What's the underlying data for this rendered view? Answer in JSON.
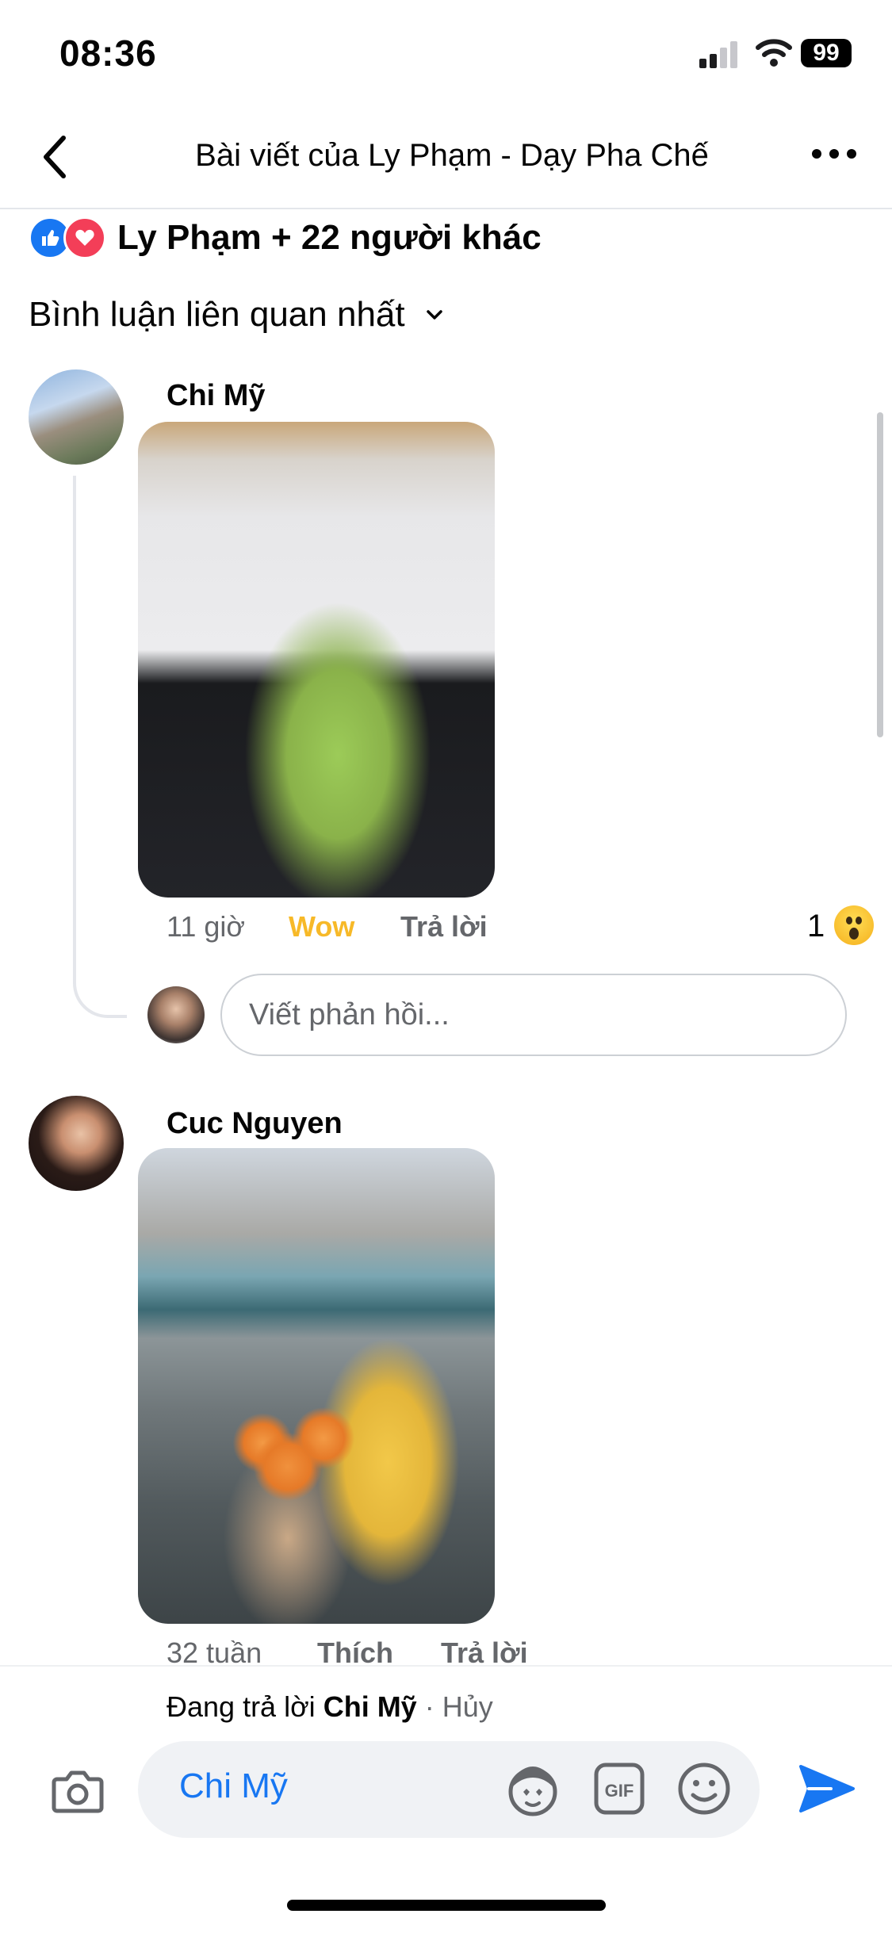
{
  "status_bar": {
    "time": "08:36",
    "battery": "99"
  },
  "nav": {
    "title": "Bài viết của Ly Phạm - Dạy Pha Chế"
  },
  "reactions": {
    "text": "Ly Phạm + 22 người khác"
  },
  "sort": {
    "label": "Bình luận liên quan nhất"
  },
  "comments": [
    {
      "name": "Chi Mỹ",
      "time": "11 giờ",
      "reaction_label": "Wow",
      "reply_label": "Trả lời",
      "reaction_count": "1",
      "reaction_icon": "wow-icon"
    },
    {
      "name": "Cuc Nguyen",
      "time": "32 tuần",
      "like_label": "Thích",
      "reply_label": "Trả lời"
    }
  ],
  "reply_box": {
    "placeholder": "Viết phản hồi..."
  },
  "composer": {
    "replying_prefix": "Đang trả lời",
    "replying_name": "Chi Mỹ",
    "separator": "·",
    "cancel": "Hủy",
    "text": "Chi Mỹ"
  },
  "colors": {
    "accent": "#1877f2",
    "wow": "#f7b928",
    "love": "#f33e58",
    "secondary_text": "#65676b"
  }
}
